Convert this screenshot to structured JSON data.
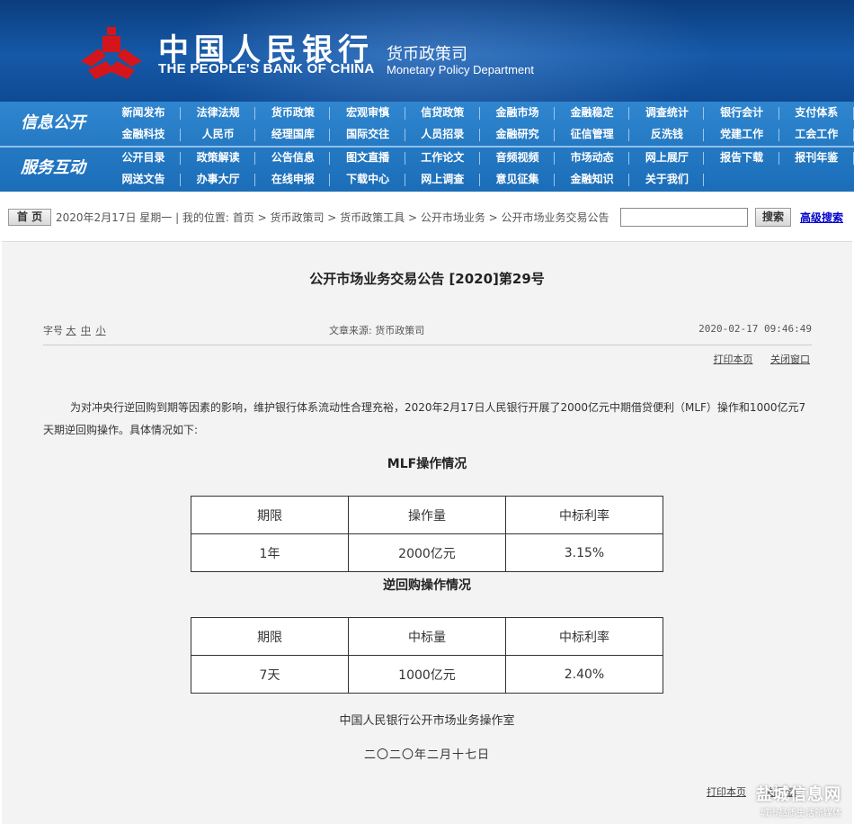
{
  "header": {
    "bank_cn": "中国人民银行",
    "bank_en": "THE PEOPLE'S BANK OF CHINA",
    "dept_cn": "货币政策司",
    "dept_en": "Monetary Policy Department",
    "emblem_icon": "pboc-emblem-icon",
    "emblem_color": "#d4161c"
  },
  "nav": {
    "group1_label": "信息公开",
    "group2_label": "服务互动",
    "row1": [
      "新闻发布",
      "法律法规",
      "货币政策",
      "宏观审慎",
      "信贷政策",
      "金融市场",
      "金融稳定",
      "调查统计",
      "银行会计",
      "支付体系"
    ],
    "row2": [
      "金融科技",
      "人民币",
      "经理国库",
      "国际交往",
      "人员招录",
      "金融研究",
      "征信管理",
      "反洗钱",
      "党建工作",
      "工会工作"
    ],
    "row3": [
      "公开目录",
      "政策解读",
      "公告信息",
      "图文直播",
      "工作论文",
      "音频视频",
      "市场动态",
      "网上展厅",
      "报告下载",
      "报刊年鉴"
    ],
    "row4": [
      "网送文告",
      "办事大厅",
      "在线申报",
      "下载中心",
      "网上调查",
      "意见征集",
      "金融知识",
      "关于我们"
    ]
  },
  "crumbs": {
    "home_label": "首 页",
    "text": "2020年2月17日 星期一 | 我的位置: 首页 > 货币政策司 > 货币政策工具 > 公开市场业务 > 公开市场业务交易公告",
    "search_value": "",
    "search_label": "搜索",
    "adv_search_label": "高级搜索"
  },
  "article": {
    "title": "公开市场业务交易公告 [2020]第29号",
    "font_size_label": "字号",
    "size_large": "大",
    "size_medium": "中",
    "size_small": "小",
    "source": "文章来源: 货币政策司",
    "datetime": "2020-02-17 09:46:49",
    "print_label": "打印本页",
    "close_label": "关闭窗口",
    "paragraph": "为对冲央行逆回购到期等因素的影响，维护银行体系流动性合理充裕，2020年2月17日人民银行开展了2000亿元中期借贷便利（MLF）操作和1000亿元7天期逆回购操作。具体情况如下:",
    "mlf_title": "MLF操作情况",
    "mlf_table": {
      "headers": [
        "期限",
        "操作量",
        "中标利率"
      ],
      "row": [
        "1年",
        "2000亿元",
        "3.15%"
      ]
    },
    "repo_title": "逆回购操作情况",
    "repo_table": {
      "headers": [
        "期限",
        "中标量",
        "中标利率"
      ],
      "row": [
        "7天",
        "1000亿元",
        "2.40%"
      ]
    },
    "org": "中国人民银行公开市场业务操作室",
    "date_cn": "二〇二〇年二月十七日",
    "print_label2": "打印本页",
    "close_label2": "关闭窗口"
  },
  "watermark": {
    "line1": "盐城信息网",
    "line2": "城市品质生活新媒体"
  }
}
